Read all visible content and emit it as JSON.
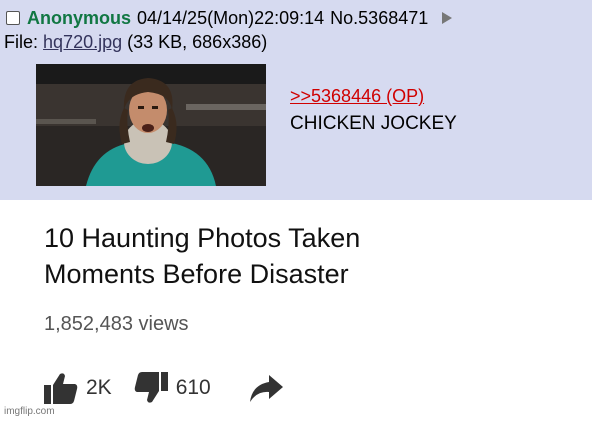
{
  "post": {
    "name": "Anonymous",
    "datetime": "04/14/25(Mon)22:09:14",
    "number": "No.5368471",
    "file_label": "File:",
    "file_name": "hq720.jpg",
    "file_info": "(33 KB, 686x386)",
    "reply_quote": ">>5368446 (OP)",
    "message": "CHICKEN JOCKEY",
    "colors": {
      "background": "#d6daf0",
      "name": "#117743",
      "quote": "#d00000"
    }
  },
  "video": {
    "title_line1": "10 Haunting Photos Taken",
    "title_line2": "Moments Before Disaster",
    "views": "1,852,483 views",
    "likes": "2K",
    "dislikes": "610",
    "icons": [
      "thumbs-up-icon",
      "thumbs-down-icon",
      "share-icon"
    ]
  },
  "watermark": "imgflip.com"
}
